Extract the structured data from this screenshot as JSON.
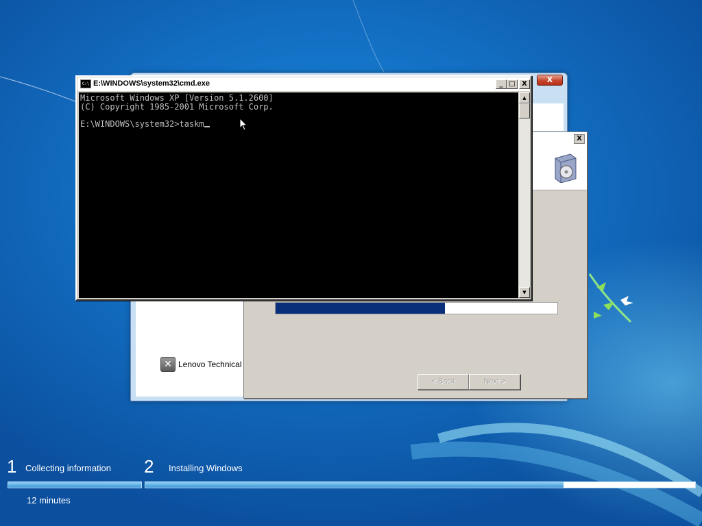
{
  "setup_window": {
    "close_glyph": "X",
    "brand_label": "Lenovo Technical"
  },
  "wizard": {
    "close_glyph": "X",
    "icon": "installer-box-icon",
    "progress": 0.6,
    "back_label": "< Back",
    "next_label": "Next >"
  },
  "cmd": {
    "title": "E:\\WINDOWS\\system32\\cmd.exe",
    "min_glyph": "_",
    "max_glyph": "□",
    "close_glyph": "X",
    "lines": [
      "Microsoft Windows XP [Version 5.1.2600]",
      "(C) Copyright 1985-2001 Microsoft Corp.",
      "",
      "E:\\WINDOWS\\system32>taskm"
    ]
  },
  "setup_progress": {
    "step1": {
      "number": "1",
      "label": "Collecting information"
    },
    "step2": {
      "number": "2",
      "label": "Installing Windows",
      "progress": 0.76
    },
    "time_remaining": "12 minutes"
  },
  "colors": {
    "desktop_blue": "#1370c4",
    "console_bg": "#000000",
    "console_text": "#c0c0c0",
    "wizard_progress": "#0a2f7a"
  }
}
